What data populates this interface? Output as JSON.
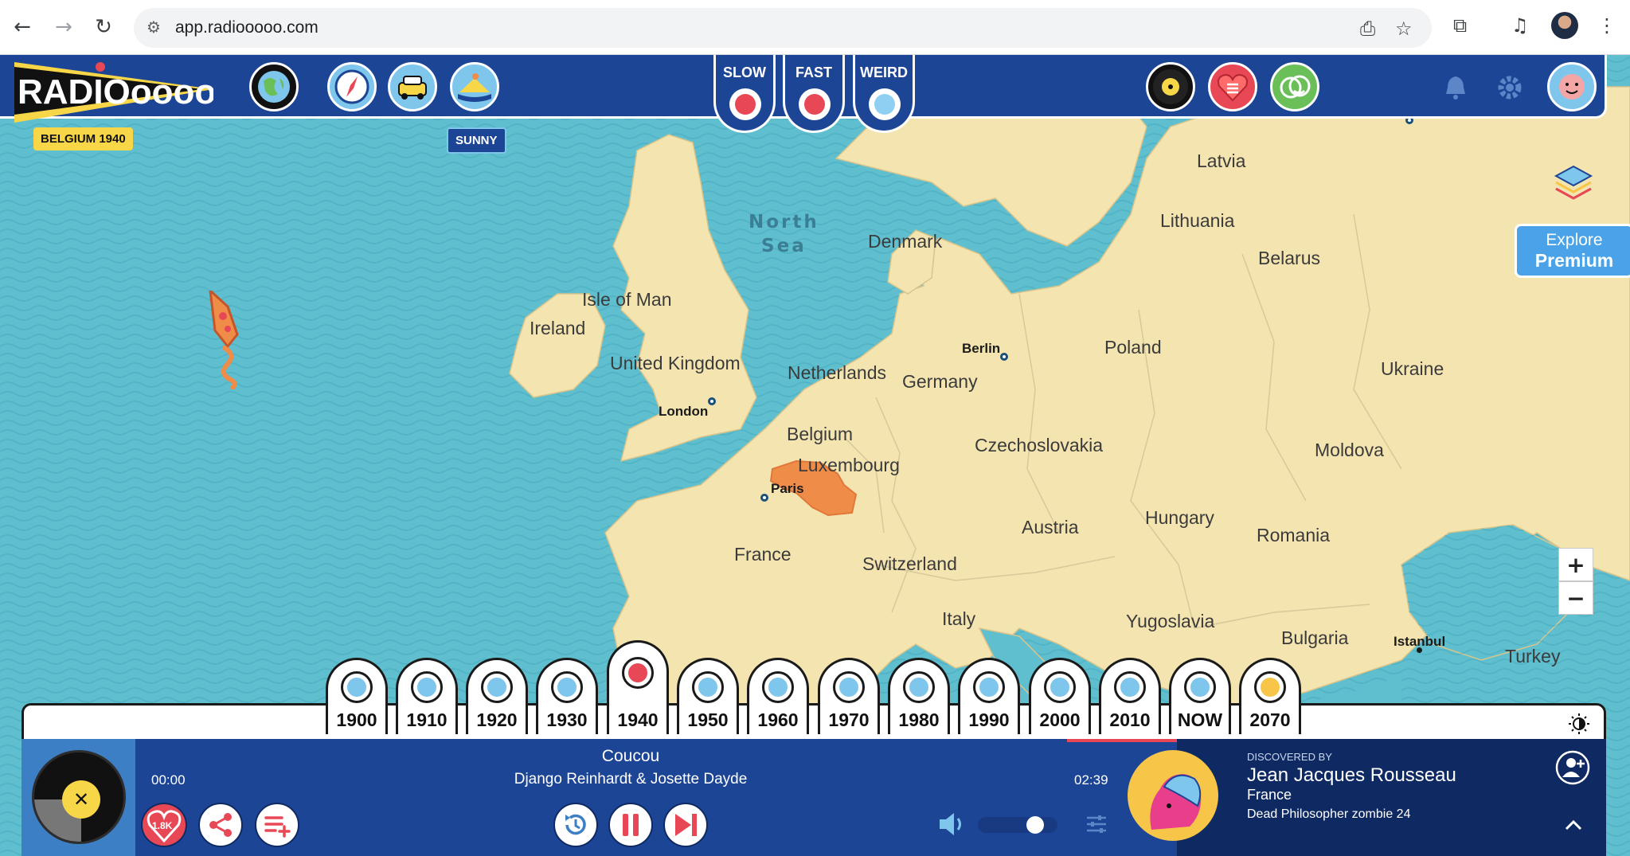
{
  "browser": {
    "url": "app.radiooooo.com",
    "icons": [
      "back-arrow-icon",
      "forward-arrow-icon",
      "reload-icon",
      "site-settings-icon",
      "install-app-icon",
      "bookmark-star-icon",
      "extensions-icon",
      "media-controls-icon",
      "profile-avatar",
      "browser-menu-icon"
    ]
  },
  "app": {
    "logo_text": "RADIOoooo",
    "location_tag": "BELGIUM 1940",
    "weather_tag": "SUNNY",
    "top_icons_left": [
      "globe-icon",
      "compass-icon",
      "taxi-icon",
      "island-icon"
    ],
    "moods": [
      {
        "label": "SLOW",
        "active": true,
        "color": "#e84855"
      },
      {
        "label": "FAST",
        "active": true,
        "color": "#e84855"
      },
      {
        "label": "WEIRD",
        "active": false,
        "color": "#8fd0f2"
      }
    ],
    "top_icons_right": [
      "record-icon",
      "heart-list-icon",
      "smiley-icon",
      "bell-icon",
      "gear-icon",
      "user-avatar"
    ],
    "explore": {
      "line1": "Explore",
      "line2": "Premium"
    },
    "zoom": {
      "in": "+",
      "out": "−"
    }
  },
  "map": {
    "countries": [
      "Latvia",
      "Lithuania",
      "Belarus",
      "Denmark",
      "Isle of Man",
      "Ireland",
      "United Kingdom",
      "Netherlands",
      "Germany",
      "Poland",
      "Ukraine",
      "Belgium",
      "Luxembourg",
      "Czechoslovakia",
      "Moldova",
      "Hungary",
      "Romania",
      "Austria",
      "France",
      "Switzerland",
      "Italy",
      "Yugoslavia",
      "Bulgaria",
      "Turkey"
    ],
    "sea_line1": "North",
    "sea_line2": "Sea",
    "cities": [
      "Berlin",
      "London",
      "Paris",
      "Istanbul"
    ],
    "selected_country": "Belgium"
  },
  "timeline": {
    "decades": [
      "1900",
      "1910",
      "1920",
      "1930",
      "1940",
      "1950",
      "1960",
      "1970",
      "1980",
      "1990",
      "2000",
      "2010",
      "NOW",
      "2070"
    ],
    "selected": "1940"
  },
  "player": {
    "title": "Coucou",
    "artist": "Django Reinhardt & Josette Dayde",
    "elapsed": "00:00",
    "duration": "02:39",
    "like_count": "1.8K",
    "volume": 0.78,
    "progress": 0.0
  },
  "discovered": {
    "label": "DISCOVERED BY",
    "name": "Jean Jacques Rousseau",
    "country": "France",
    "subtitle": "Dead Philosopher zombie 24"
  },
  "colors": {
    "sea": "#5fbfcf",
    "land": "#f4e4b0",
    "selected": "#ef8c48",
    "bar": "#1d4596",
    "accent_red": "#e84855"
  }
}
